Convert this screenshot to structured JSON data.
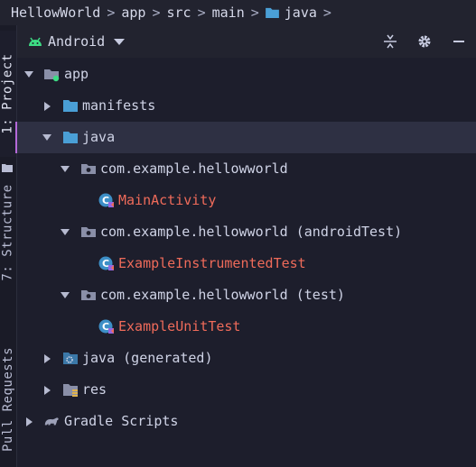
{
  "breadcrumb": {
    "items": [
      "HellowWorld",
      "app",
      "src",
      "main",
      "java"
    ],
    "separator": ">"
  },
  "toolstrip": {
    "tabs": [
      "1: Project",
      "7: Structure",
      "Pull Requests"
    ]
  },
  "panel": {
    "view_mode": "Android",
    "icons": [
      "collapse-all-icon",
      "gear-icon",
      "minimize-icon"
    ]
  },
  "tree": {
    "rows": [
      {
        "label": "app"
      },
      {
        "label": "manifests"
      },
      {
        "label": "java"
      },
      {
        "label": "com.example.hellowworld"
      },
      {
        "label": "MainActivity"
      },
      {
        "label": "com.example.hellowworld (androidTest)"
      },
      {
        "label": "ExampleInstrumentedTest"
      },
      {
        "label": "com.example.hellowworld (test)"
      },
      {
        "label": "ExampleUnitTest"
      },
      {
        "label": "java (generated)"
      },
      {
        "label": "res"
      },
      {
        "label": "Gradle Scripts"
      }
    ]
  },
  "colors": {
    "background": "#1d1e2c",
    "folder": "#4a9fd6",
    "class_name": "#ef6b5a",
    "selection": "#2e3043",
    "accent": "#b569d9"
  }
}
